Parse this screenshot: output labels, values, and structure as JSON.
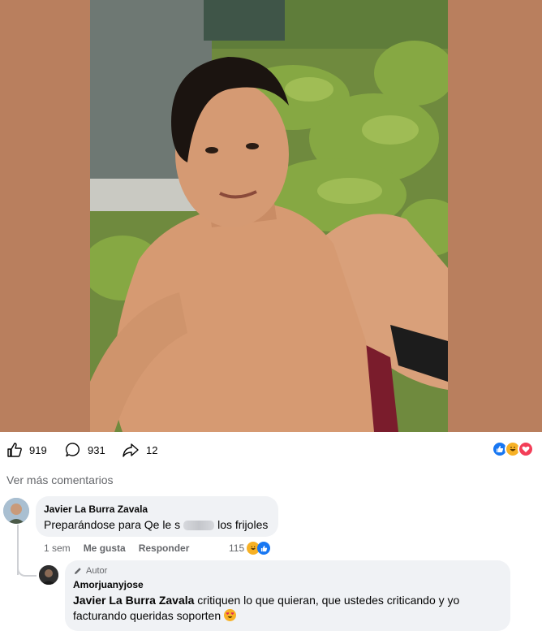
{
  "post": {
    "photo_alt": "",
    "reactions": {
      "like_count": "919",
      "comment_count": "931",
      "share_count": "12"
    }
  },
  "comments_section": {
    "view_more_label": "Ver más comentarios",
    "comments": [
      {
        "author": "Javier La Burra Zavala",
        "text_before": "Preparándose para Qe le s",
        "text_after": "los frijoles",
        "time": "1 sem",
        "like_label": "Me gusta",
        "reply_label": "Responder",
        "reaction_count": "115"
      },
      {
        "badge": "Autor",
        "author": "Amorjuanyjose",
        "mention": "Javier La Burra Zavala",
        "text": " critiquen lo que quieran, que ustedes criticando y yo facturando queridas soporten"
      }
    ]
  },
  "colors": {
    "background_side": "#b97f5e",
    "like_blue": "#1877f2",
    "love_red": "#f33e58",
    "haha_yellow": "#f7b125",
    "bubble_gray": "#f0f2f5",
    "secondary_text": "#65676b"
  }
}
